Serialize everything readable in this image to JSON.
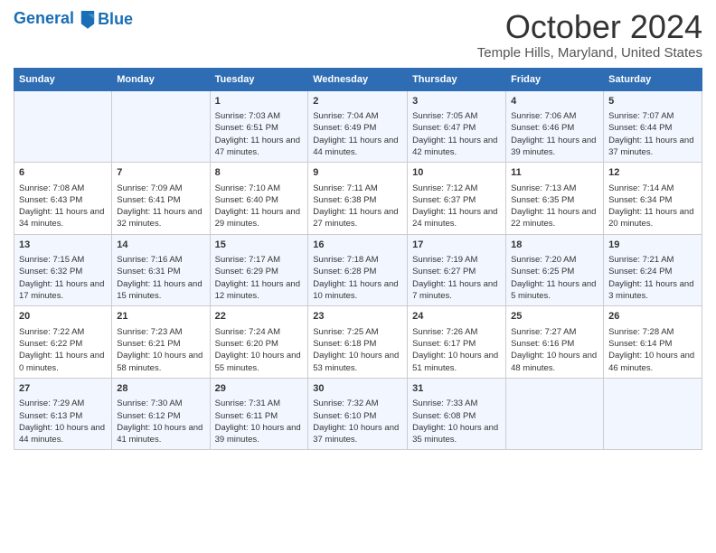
{
  "header": {
    "logo_line1": "General",
    "logo_line2": "Blue",
    "month_title": "October 2024",
    "location": "Temple Hills, Maryland, United States"
  },
  "days_of_week": [
    "Sunday",
    "Monday",
    "Tuesday",
    "Wednesday",
    "Thursday",
    "Friday",
    "Saturday"
  ],
  "weeks": [
    [
      {
        "day": "",
        "info": ""
      },
      {
        "day": "",
        "info": ""
      },
      {
        "day": "1",
        "info": "Sunrise: 7:03 AM\nSunset: 6:51 PM\nDaylight: 11 hours and 47 minutes."
      },
      {
        "day": "2",
        "info": "Sunrise: 7:04 AM\nSunset: 6:49 PM\nDaylight: 11 hours and 44 minutes."
      },
      {
        "day": "3",
        "info": "Sunrise: 7:05 AM\nSunset: 6:47 PM\nDaylight: 11 hours and 42 minutes."
      },
      {
        "day": "4",
        "info": "Sunrise: 7:06 AM\nSunset: 6:46 PM\nDaylight: 11 hours and 39 minutes."
      },
      {
        "day": "5",
        "info": "Sunrise: 7:07 AM\nSunset: 6:44 PM\nDaylight: 11 hours and 37 minutes."
      }
    ],
    [
      {
        "day": "6",
        "info": "Sunrise: 7:08 AM\nSunset: 6:43 PM\nDaylight: 11 hours and 34 minutes."
      },
      {
        "day": "7",
        "info": "Sunrise: 7:09 AM\nSunset: 6:41 PM\nDaylight: 11 hours and 32 minutes."
      },
      {
        "day": "8",
        "info": "Sunrise: 7:10 AM\nSunset: 6:40 PM\nDaylight: 11 hours and 29 minutes."
      },
      {
        "day": "9",
        "info": "Sunrise: 7:11 AM\nSunset: 6:38 PM\nDaylight: 11 hours and 27 minutes."
      },
      {
        "day": "10",
        "info": "Sunrise: 7:12 AM\nSunset: 6:37 PM\nDaylight: 11 hours and 24 minutes."
      },
      {
        "day": "11",
        "info": "Sunrise: 7:13 AM\nSunset: 6:35 PM\nDaylight: 11 hours and 22 minutes."
      },
      {
        "day": "12",
        "info": "Sunrise: 7:14 AM\nSunset: 6:34 PM\nDaylight: 11 hours and 20 minutes."
      }
    ],
    [
      {
        "day": "13",
        "info": "Sunrise: 7:15 AM\nSunset: 6:32 PM\nDaylight: 11 hours and 17 minutes."
      },
      {
        "day": "14",
        "info": "Sunrise: 7:16 AM\nSunset: 6:31 PM\nDaylight: 11 hours and 15 minutes."
      },
      {
        "day": "15",
        "info": "Sunrise: 7:17 AM\nSunset: 6:29 PM\nDaylight: 11 hours and 12 minutes."
      },
      {
        "day": "16",
        "info": "Sunrise: 7:18 AM\nSunset: 6:28 PM\nDaylight: 11 hours and 10 minutes."
      },
      {
        "day": "17",
        "info": "Sunrise: 7:19 AM\nSunset: 6:27 PM\nDaylight: 11 hours and 7 minutes."
      },
      {
        "day": "18",
        "info": "Sunrise: 7:20 AM\nSunset: 6:25 PM\nDaylight: 11 hours and 5 minutes."
      },
      {
        "day": "19",
        "info": "Sunrise: 7:21 AM\nSunset: 6:24 PM\nDaylight: 11 hours and 3 minutes."
      }
    ],
    [
      {
        "day": "20",
        "info": "Sunrise: 7:22 AM\nSunset: 6:22 PM\nDaylight: 11 hours and 0 minutes."
      },
      {
        "day": "21",
        "info": "Sunrise: 7:23 AM\nSunset: 6:21 PM\nDaylight: 10 hours and 58 minutes."
      },
      {
        "day": "22",
        "info": "Sunrise: 7:24 AM\nSunset: 6:20 PM\nDaylight: 10 hours and 55 minutes."
      },
      {
        "day": "23",
        "info": "Sunrise: 7:25 AM\nSunset: 6:18 PM\nDaylight: 10 hours and 53 minutes."
      },
      {
        "day": "24",
        "info": "Sunrise: 7:26 AM\nSunset: 6:17 PM\nDaylight: 10 hours and 51 minutes."
      },
      {
        "day": "25",
        "info": "Sunrise: 7:27 AM\nSunset: 6:16 PM\nDaylight: 10 hours and 48 minutes."
      },
      {
        "day": "26",
        "info": "Sunrise: 7:28 AM\nSunset: 6:14 PM\nDaylight: 10 hours and 46 minutes."
      }
    ],
    [
      {
        "day": "27",
        "info": "Sunrise: 7:29 AM\nSunset: 6:13 PM\nDaylight: 10 hours and 44 minutes."
      },
      {
        "day": "28",
        "info": "Sunrise: 7:30 AM\nSunset: 6:12 PM\nDaylight: 10 hours and 41 minutes."
      },
      {
        "day": "29",
        "info": "Sunrise: 7:31 AM\nSunset: 6:11 PM\nDaylight: 10 hours and 39 minutes."
      },
      {
        "day": "30",
        "info": "Sunrise: 7:32 AM\nSunset: 6:10 PM\nDaylight: 10 hours and 37 minutes."
      },
      {
        "day": "31",
        "info": "Sunrise: 7:33 AM\nSunset: 6:08 PM\nDaylight: 10 hours and 35 minutes."
      },
      {
        "day": "",
        "info": ""
      },
      {
        "day": "",
        "info": ""
      }
    ]
  ]
}
